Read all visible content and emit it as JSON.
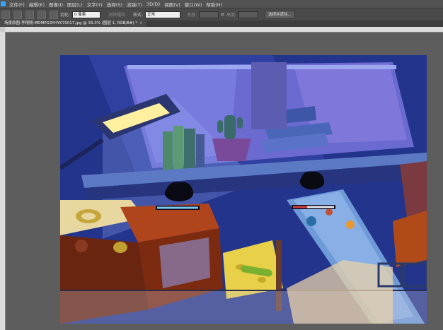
{
  "menu": [
    "文件(F)",
    "编辑(E)",
    "图像(I)",
    "图层(L)",
    "文字(Y)",
    "选择(S)",
    "滤镜(T)",
    "3D(D)",
    "视图(V)",
    "窗口(W)",
    "帮助(H)"
  ],
  "options": {
    "feather_label": "羽化:",
    "feather_value": "0 像素",
    "antialias_label": "消除锯齿",
    "style_label": "样式:",
    "style_value": "正常",
    "width_label": "宽度:",
    "height_label": "高度:",
    "select_mask_button": "选择并遮住..."
  },
  "document_tab": {
    "title": "场景原图-李翔翔-MDMPG3YHYK70017.jpg @ 33.3% (图层 1, RGB/8#) *",
    "close": "×"
  },
  "colors": {
    "accent": "#31a8ff",
    "panel": "#535353",
    "workspace": "#5d5d5d"
  }
}
